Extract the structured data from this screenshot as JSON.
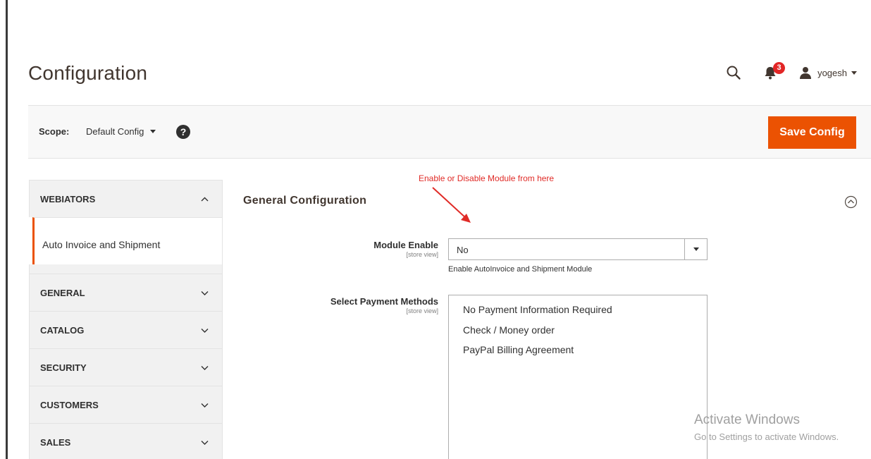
{
  "header": {
    "title": "Configuration",
    "notifications_count": "3",
    "user_name": "yogesh"
  },
  "scope": {
    "label": "Scope:",
    "current": "Default Config",
    "help": "?"
  },
  "actions": {
    "save_label": "Save Config",
    "accent": "#eb5202"
  },
  "sidebar": {
    "sections": [
      {
        "label": "WEBIATORS",
        "expanded": true
      },
      {
        "label": "GENERAL",
        "expanded": false
      },
      {
        "label": "CATALOG",
        "expanded": false
      },
      {
        "label": "SECURITY",
        "expanded": false
      },
      {
        "label": "CUSTOMERS",
        "expanded": false
      },
      {
        "label": "SALES",
        "expanded": false
      }
    ],
    "active_item": "Auto Invoice and Shipment"
  },
  "annotation": {
    "text": "Enable or Disable Module from here",
    "color": "#e02b27"
  },
  "section": {
    "title": "General Configuration",
    "fields": {
      "module_enable": {
        "label": "Module Enable",
        "scope": "[store view]",
        "value": "No",
        "note": "Enable AutoInvoice and Shipment Module"
      },
      "payment_methods": {
        "label": "Select Payment Methods",
        "scope": "[store view]",
        "options": [
          "No Payment Information Required",
          "Check / Money order",
          "PayPal Billing Agreement"
        ]
      }
    }
  },
  "watermark": {
    "title": "Activate Windows",
    "subtitle": "Go to Settings to activate Windows."
  },
  "icons": {
    "search": "search-icon",
    "bell": "bell-icon",
    "user": "user-icon",
    "chevron_up": "chevron-up-icon",
    "chevron_down": "chevron-down-icon",
    "collapse": "collapse-circle-icon"
  }
}
